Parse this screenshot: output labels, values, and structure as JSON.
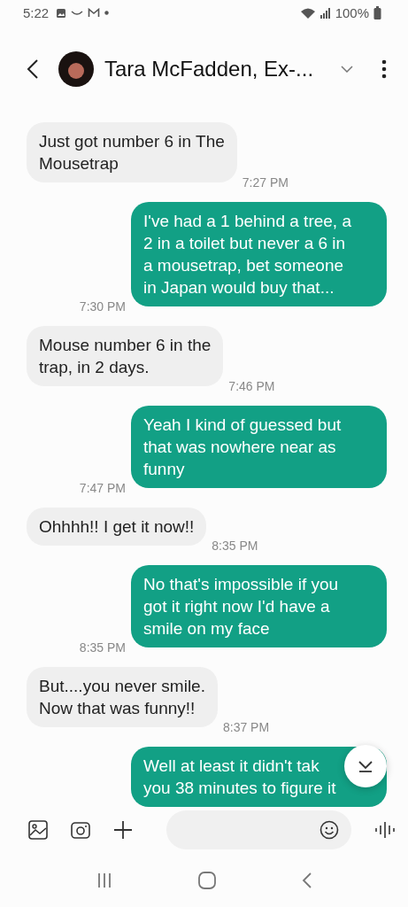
{
  "status_bar": {
    "time": "5:22",
    "battery": "100%"
  },
  "header": {
    "title": "Tara McFadden, Ex-..."
  },
  "messages": [
    {
      "kind": "received",
      "text": "Just got number 6 in The\nMousetrap",
      "time": "7:27 PM"
    },
    {
      "kind": "sent",
      "text": "I've had a 1 behind a tree, a\n2 in a toilet but never a 6 in\na mousetrap, bet someone\nin Japan would buy that...",
      "time": "7:30 PM"
    },
    {
      "kind": "received",
      "text": "Mouse number 6 in the\ntrap, in 2 days.",
      "time": "7:46 PM"
    },
    {
      "kind": "sent",
      "text": "Yeah I kind of guessed but\nthat was nowhere near as\nfunny",
      "time": "7:47 PM"
    },
    {
      "kind": "received",
      "text": "Ohhhh!! I get it now!!",
      "time": "8:35 PM"
    },
    {
      "kind": "sent",
      "text": "No that's impossible if you\ngot it right now I'd have a\nsmile on my face",
      "time": "8:35 PM"
    },
    {
      "kind": "received",
      "text": "But....you never smile.\nNow that was funny!!",
      "time": "8:37 PM"
    },
    {
      "kind": "sent",
      "text": "Well at least it didn't tak\nyou 38 minutes to figure it"
    }
  ]
}
